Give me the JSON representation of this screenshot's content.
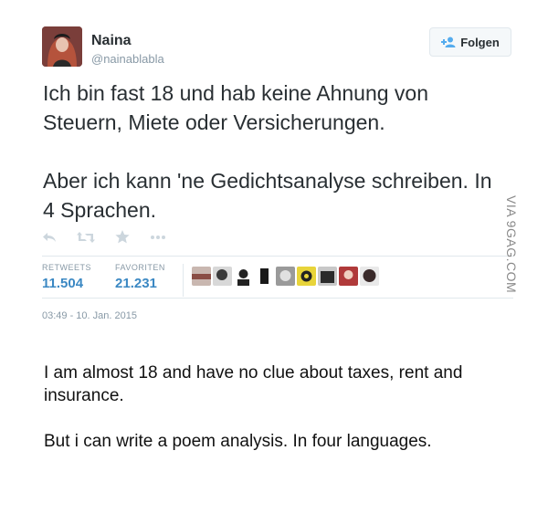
{
  "user": {
    "name": "Naina",
    "handle": "@nainablabla",
    "avatar_color": "#6b3a3a"
  },
  "follow_button": {
    "label": "Folgen",
    "icon": "add-user-icon"
  },
  "tweet": {
    "paragraphs": [
      "Ich bin fast 18 und hab keine Ahnung von Steuern, Miete oder Versicherungen.",
      "Aber ich kann 'ne Gedichtsanalyse schreiben. In 4 Sprachen."
    ]
  },
  "actions": [
    {
      "name": "reply-icon"
    },
    {
      "name": "retweet-icon"
    },
    {
      "name": "favorite-star-icon"
    },
    {
      "name": "more-icon"
    }
  ],
  "stats": {
    "retweets_label": "RETWEETS",
    "retweets_value": "11.504",
    "favorites_label": "FAVORITEN",
    "favorites_value": "21.231"
  },
  "favoriters_count": 10,
  "timestamp": "03:49 - 10. Jan. 2015",
  "translation": {
    "paragraphs": [
      "I am almost 18 and have no clue about taxes, rent and insurance.",
      "But i can write a poem analysis. In four languages."
    ]
  },
  "watermark": "VIA 9GAG.COM",
  "colors": {
    "link_blue": "#3b88c3",
    "muted_gray": "#8899a6",
    "text_dark": "#292f33",
    "border": "#e1e8ed"
  }
}
